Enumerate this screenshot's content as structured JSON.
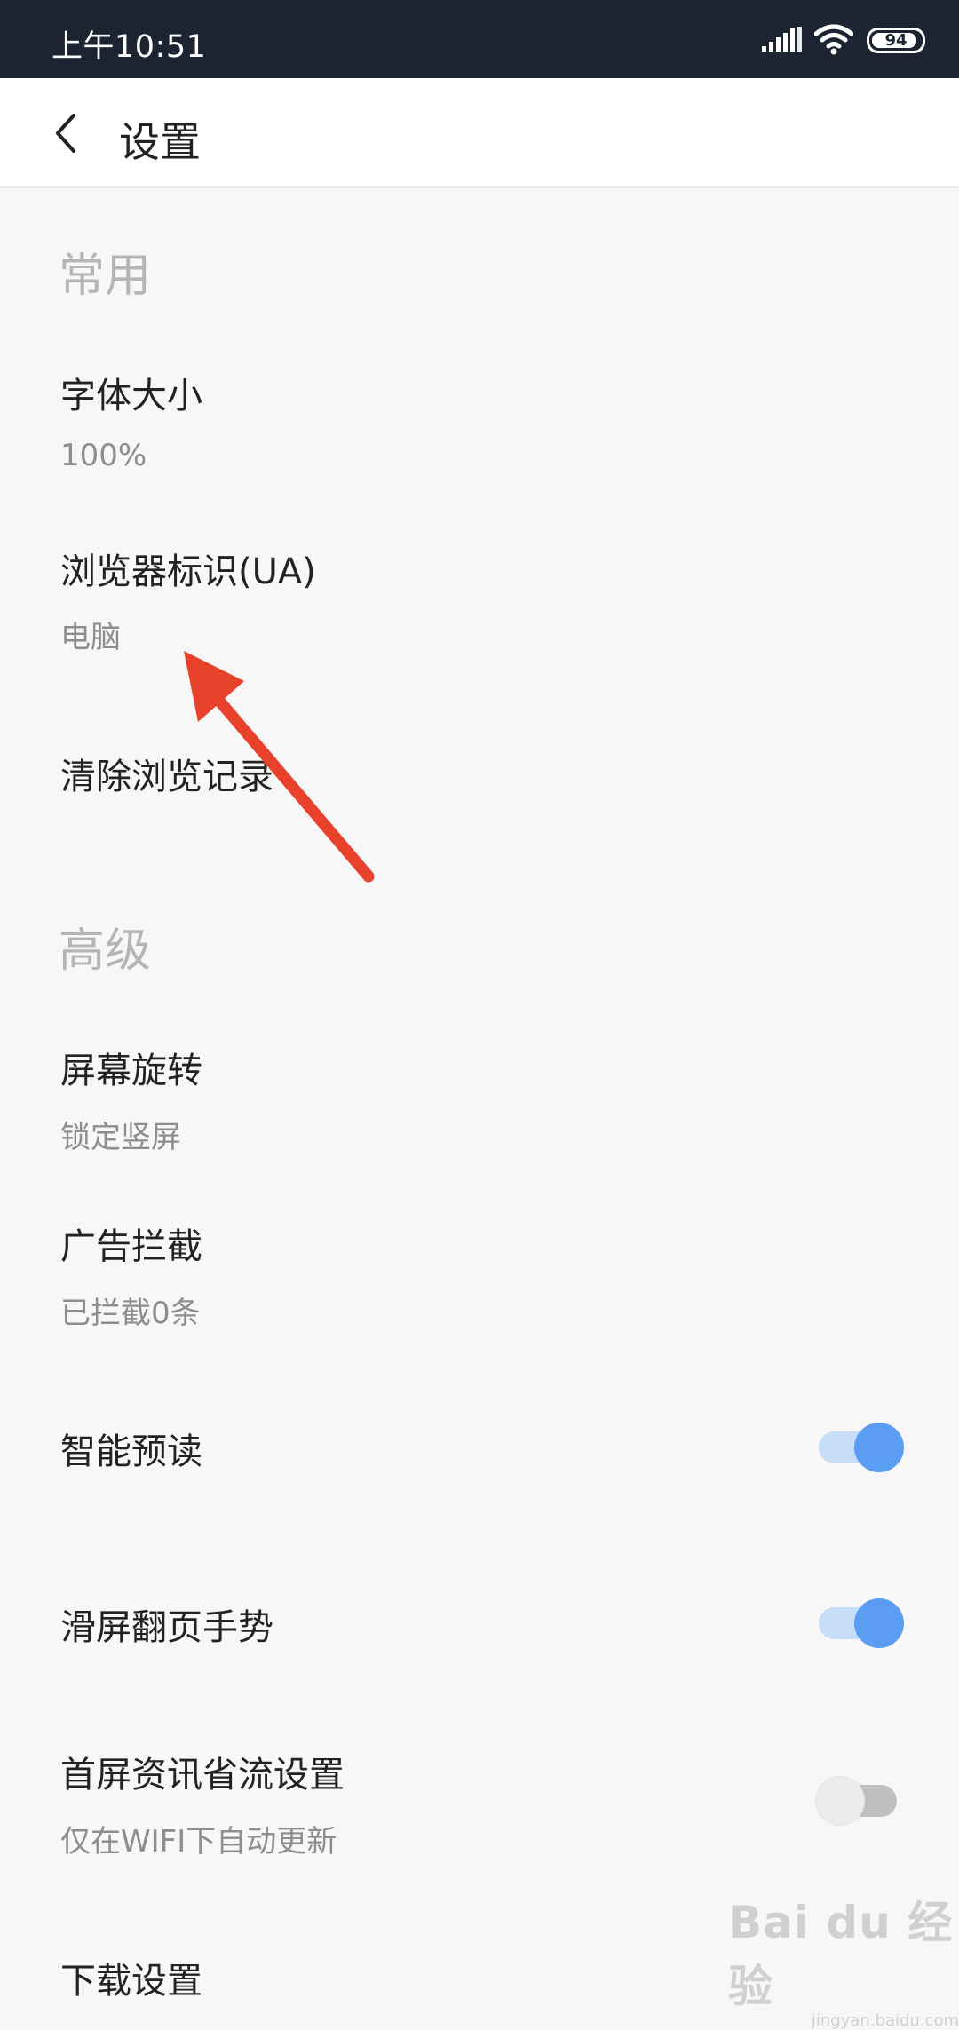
{
  "status_bar": {
    "time": "上午10:51",
    "battery_level": "94",
    "icons": [
      "signal-icon",
      "wifi-icon",
      "battery-icon"
    ]
  },
  "header": {
    "back_icon": "chevron-left-icon",
    "title": "设置"
  },
  "sections": {
    "common": {
      "title": "常用",
      "font_size": {
        "title": "字体大小",
        "value": "100%"
      },
      "ua": {
        "title": "浏览器标识(UA)",
        "value": "电脑"
      },
      "clear_history": {
        "title": "清除浏览记录"
      }
    },
    "advanced": {
      "title": "高级",
      "rotation": {
        "title": "屏幕旋转",
        "value": "锁定竖屏"
      },
      "ad_block": {
        "title": "广告拦截",
        "value": "已拦截0条"
      },
      "smart_preread": {
        "title": "智能预读",
        "enabled": true
      },
      "swipe_gesture": {
        "title": "滑屏翻页手势",
        "enabled": true
      },
      "data_saving": {
        "title": "首屏资讯省流设置",
        "value": "仅在WIFI下自动更新",
        "enabled": false
      },
      "download": {
        "title": "下载设置"
      }
    }
  },
  "watermark": {
    "main": "Bai du 经验",
    "sub": "jingyan.baidu.com"
  },
  "colors": {
    "status_bar_bg": "#1c2331",
    "accent": "#5a9df2",
    "arrow": "#e8412c"
  }
}
